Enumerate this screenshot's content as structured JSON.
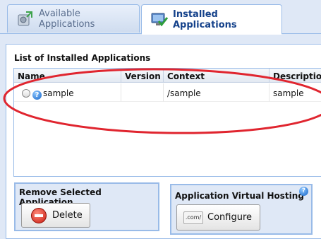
{
  "tabs": [
    {
      "label": "Available Applications",
      "icon": "gear-arrows-icon"
    },
    {
      "label": "Installed Applications",
      "icon": "monitor-check-icon"
    }
  ],
  "grid": {
    "title": "List of Installed Applications",
    "columns": [
      "Name",
      "Version",
      "Context",
      "Description"
    ],
    "rows": [
      {
        "name": "sample",
        "version": "",
        "context": "/sample",
        "description": "sample"
      }
    ]
  },
  "remove_box": {
    "title": "Remove Selected Application",
    "button_label": "Delete"
  },
  "vhost_box": {
    "title": "Application Virtual Hosting",
    "help": "?",
    "button_label": "Configure",
    "button_icon_text": ".com/"
  },
  "colors": {
    "annotation_ellipse": "#e0252f",
    "panel_border": "#99bbe8",
    "header_text": "#15428b"
  }
}
